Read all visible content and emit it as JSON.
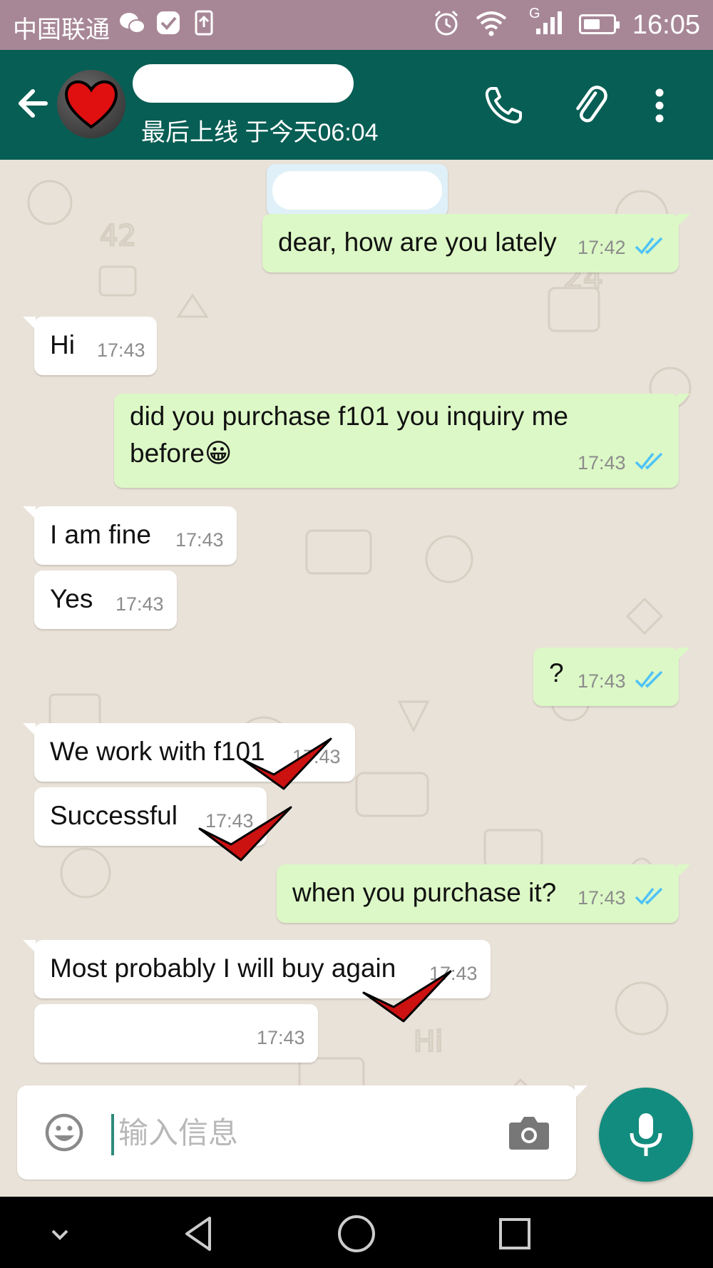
{
  "status_bar": {
    "carrier": "中国联通",
    "time": "16:05",
    "network_label": "G",
    "battery_level": 0.55
  },
  "header": {
    "last_seen": "最后上线 于今天06:04",
    "icons": [
      "back-arrow-icon",
      "call-icon",
      "attach-icon",
      "more-vert-icon"
    ]
  },
  "messages": [
    {
      "dir": "out",
      "text": "dear, how are you lately",
      "time": "17:42",
      "read": true
    },
    {
      "dir": "in",
      "text": "Hi",
      "time": "17:43"
    },
    {
      "dir": "out",
      "text_line1": "did you purchase f101 you inquiry me",
      "text_line2": "before",
      "emoji": "😀",
      "time": "17:43",
      "read": true
    },
    {
      "dir": "in",
      "text": "I am fine",
      "time": "17:43"
    },
    {
      "dir": "in",
      "text": "Yes",
      "time": "17:43"
    },
    {
      "dir": "out",
      "text": "?",
      "time": "17:43",
      "read": true
    },
    {
      "dir": "in",
      "text": "We work with f101",
      "time": "17:43"
    },
    {
      "dir": "in",
      "text": "Successful",
      "time": "17:43"
    },
    {
      "dir": "out",
      "text": "when you purchase it?",
      "time": "17:43",
      "read": true
    },
    {
      "dir": "in",
      "text": "Most probably I will buy again",
      "time": "17:43"
    },
    {
      "dir": "in",
      "text": "",
      "time": "17:43"
    }
  ],
  "composer": {
    "placeholder": "输入信息",
    "value": ""
  },
  "colors": {
    "header": "#075e54",
    "outgoing": "#dcf8c6",
    "incoming": "#ffffff",
    "accent": "#128c7e",
    "read_ticks": "#4fc3f7",
    "annotation_check": "#cc1111"
  }
}
